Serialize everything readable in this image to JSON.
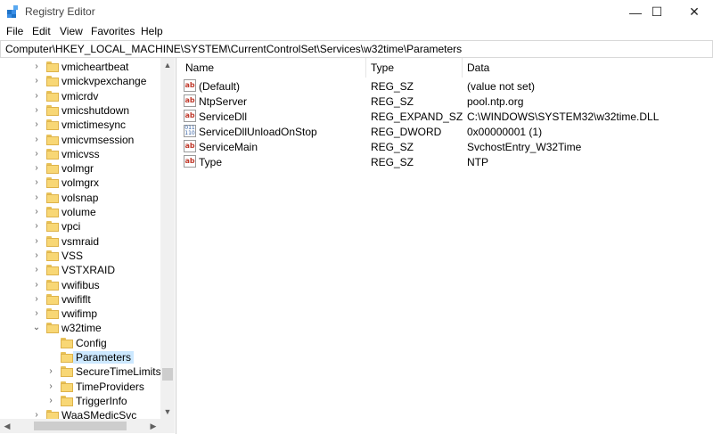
{
  "window": {
    "title": "Registry Editor"
  },
  "menu": [
    "File",
    "Edit",
    "View",
    "Favorites",
    "Help"
  ],
  "address": {
    "path": "Computer\\HKEY_LOCAL_MACHINE\\SYSTEM\\CurrentControlSet\\Services\\w32time\\Parameters"
  },
  "tree": {
    "items": [
      {
        "label": "vmicheartbeat",
        "state": "collapsed"
      },
      {
        "label": "vmickvpexchange",
        "state": "collapsed"
      },
      {
        "label": "vmicrdv",
        "state": "collapsed"
      },
      {
        "label": "vmicshutdown",
        "state": "collapsed"
      },
      {
        "label": "vmictimesync",
        "state": "collapsed"
      },
      {
        "label": "vmicvmsession",
        "state": "collapsed"
      },
      {
        "label": "vmicvss",
        "state": "collapsed"
      },
      {
        "label": "volmgr",
        "state": "collapsed"
      },
      {
        "label": "volmgrx",
        "state": "collapsed"
      },
      {
        "label": "volsnap",
        "state": "collapsed"
      },
      {
        "label": "volume",
        "state": "collapsed"
      },
      {
        "label": "vpci",
        "state": "collapsed"
      },
      {
        "label": "vsmraid",
        "state": "collapsed"
      },
      {
        "label": "VSS",
        "state": "collapsed"
      },
      {
        "label": "VSTXRAID",
        "state": "collapsed"
      },
      {
        "label": "vwifibus",
        "state": "collapsed"
      },
      {
        "label": "vwififlt",
        "state": "collapsed"
      },
      {
        "label": "vwifimp",
        "state": "collapsed"
      },
      {
        "label": "w32time",
        "state": "expanded"
      },
      {
        "label": "Config",
        "state": "leaf",
        "child": true
      },
      {
        "label": "Parameters",
        "state": "leaf",
        "child": true,
        "selected": true
      },
      {
        "label": "SecureTimeLimits",
        "state": "collapsed",
        "child": true
      },
      {
        "label": "TimeProviders",
        "state": "collapsed",
        "child": true
      },
      {
        "label": "TriggerInfo",
        "state": "collapsed",
        "child": true
      },
      {
        "label": "WaaSMedicSvc",
        "state": "collapsed"
      }
    ]
  },
  "list": {
    "columns": [
      "Name",
      "Type",
      "Data"
    ],
    "rows": [
      {
        "name": "(Default)",
        "type": "REG_SZ",
        "data": "(value not set)",
        "icon": "string-value-icon"
      },
      {
        "name": "NtpServer",
        "type": "REG_SZ",
        "data": "pool.ntp.org",
        "icon": "string-value-icon"
      },
      {
        "name": "ServiceDll",
        "type": "REG_EXPAND_SZ",
        "data": "C:\\WINDOWS\\SYSTEM32\\w32time.DLL",
        "icon": "string-value-icon"
      },
      {
        "name": "ServiceDllUnloadOnStop",
        "type": "REG_DWORD",
        "data": "0x00000001 (1)",
        "icon": "binary-value-icon"
      },
      {
        "name": "ServiceMain",
        "type": "REG_SZ",
        "data": "SvchostEntry_W32Time",
        "icon": "string-value-icon"
      },
      {
        "name": "Type",
        "type": "REG_SZ",
        "data": "NTP",
        "icon": "string-value-icon"
      }
    ]
  },
  "icons": {
    "string_value": "ab",
    "binary_value": "011\n110",
    "minimize": "—",
    "maximize": "☐",
    "close": "✕",
    "chevron_right": "›",
    "chevron_down": "⌄",
    "scroll_up": "▲",
    "scroll_down": "▼",
    "scroll_left": "◀",
    "scroll_right": "▶"
  },
  "colors": {
    "selection": "#cce8ff",
    "folder": "#f8d775"
  }
}
